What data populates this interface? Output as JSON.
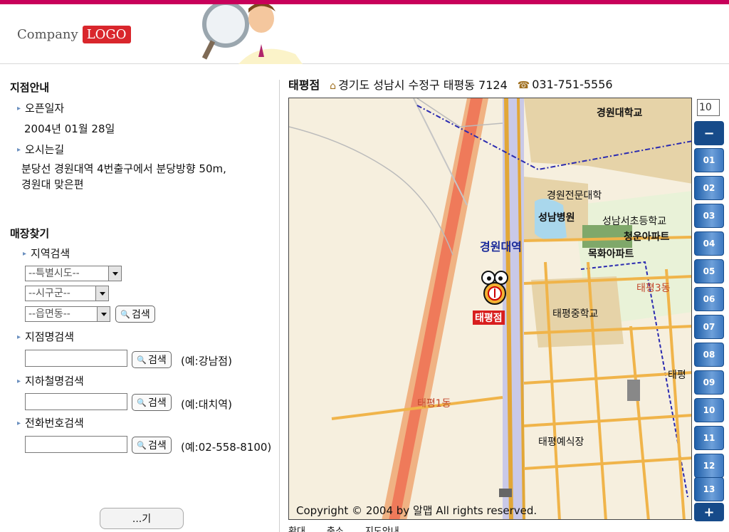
{
  "header": {
    "logo_company": "Company",
    "logo_box": "LOGO"
  },
  "sidebar": {
    "branch_title": "지점안내",
    "open_label": "오픈일자",
    "open_date": "2004년 01월 28일",
    "directions_label": "오시는길",
    "directions_line1": "분당선 경원대역 4번출구에서 분당방향 50m,",
    "directions_line2": "경원대 맞은편",
    "search_title": "매장찾기",
    "region_label": "지역검색",
    "select_city": "--특별시도--",
    "select_district": "--시구군--",
    "select_town": "--읍면동--",
    "search_btn": "검색",
    "branch_name_label": "지점명검색",
    "branch_example": "(예:강남점)",
    "subway_label": "지하철명검색",
    "subway_example": "(예:대치역)",
    "phone_label": "전화번호검색",
    "phone_example": "(예:02-558-8100)",
    "bottom_btn": "...기"
  },
  "info": {
    "store": "태평점",
    "address": "경기도 성남시 수정구 태평동 7124",
    "phone": "031-751-5556"
  },
  "map": {
    "labels": {
      "univ": "경원대학교",
      "college": "경원전문대학",
      "hospital": "성남병원",
      "elementary": "성남서초등학교",
      "apt1": "청운아파트",
      "apt2": "목화아파트",
      "station": "경원대역",
      "dong3": "태평3동",
      "store": "태평점",
      "middle": "태평중학교",
      "taepyeong": "태평",
      "dong1": "태평1동",
      "wedding": "태평예식장"
    },
    "copyright": "Copyright © 2004 by 알맵 All rights reserved."
  },
  "zoom": {
    "level": "10",
    "minus": "−",
    "plus": "+",
    "levels": [
      "01",
      "02",
      "03",
      "04",
      "05",
      "06",
      "07",
      "08",
      "09",
      "10",
      "11",
      "12",
      "13"
    ]
  },
  "bottom_tools": {
    "zoom_in": "확대",
    "zoom_out": "축소",
    "map_info": "지도안내"
  },
  "colors": {
    "topbar": "#c8005a",
    "logo": "#d9262c",
    "zoom_blue": "#1f5fa8"
  }
}
